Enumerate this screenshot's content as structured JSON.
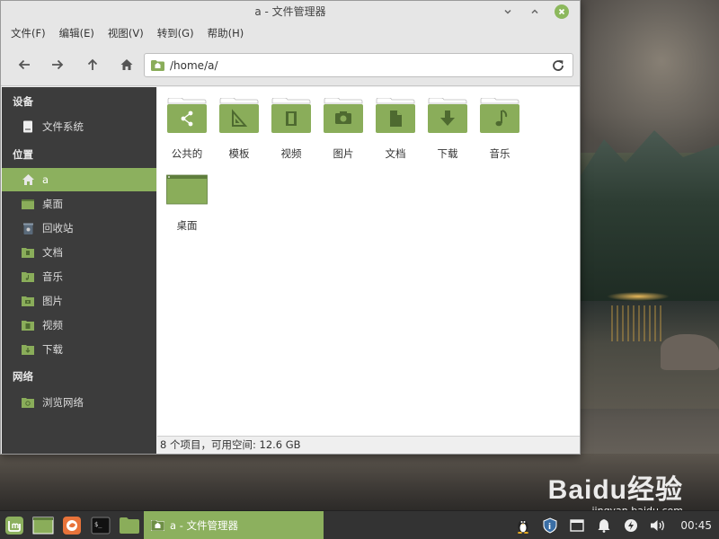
{
  "window": {
    "title": "a - 文件管理器",
    "controls": {
      "minimize": "˅",
      "maximize": "˄",
      "close": "✕"
    }
  },
  "menubar": {
    "items": [
      {
        "label": "文件(F)"
      },
      {
        "label": "编辑(E)"
      },
      {
        "label": "视图(V)"
      },
      {
        "label": "转到(G)"
      },
      {
        "label": "帮助(H)"
      }
    ]
  },
  "toolbar": {
    "back_icon": "arrow-left-icon",
    "forward_icon": "arrow-right-icon",
    "up_icon": "arrow-up-icon",
    "home_icon": "home-icon",
    "location": "/home/a/",
    "reload_icon": "reload-icon"
  },
  "sidebar": {
    "sections": [
      {
        "header": "设备",
        "items": [
          {
            "label": "文件系统",
            "icon": "drive-icon"
          }
        ]
      },
      {
        "header": "位置",
        "items": [
          {
            "label": "a",
            "icon": "home-icon",
            "active": true
          },
          {
            "label": "桌面",
            "icon": "desktop-icon"
          },
          {
            "label": "回收站",
            "icon": "trash-icon"
          },
          {
            "label": "文档",
            "icon": "documents-folder-icon"
          },
          {
            "label": "音乐",
            "icon": "music-folder-icon"
          },
          {
            "label": "图片",
            "icon": "pictures-folder-icon"
          },
          {
            "label": "视频",
            "icon": "videos-folder-icon"
          },
          {
            "label": "下载",
            "icon": "downloads-folder-icon"
          }
        ]
      },
      {
        "header": "网络",
        "items": [
          {
            "label": "浏览网络",
            "icon": "network-folder-icon"
          }
        ]
      }
    ]
  },
  "content": {
    "folders": [
      {
        "label": "公共的",
        "icon": "share-icon"
      },
      {
        "label": "模板",
        "icon": "template-icon"
      },
      {
        "label": "视频",
        "icon": "film-icon"
      },
      {
        "label": "图片",
        "icon": "camera-icon"
      },
      {
        "label": "文档",
        "icon": "document-icon"
      },
      {
        "label": "下载",
        "icon": "download-arrow-icon"
      },
      {
        "label": "音乐",
        "icon": "music-note-icon"
      },
      {
        "label": "桌面",
        "icon": "desktop-icon"
      }
    ]
  },
  "statusbar": {
    "text": "8 个项目，可用空间: 12.6 GB"
  },
  "taskbar": {
    "task_label": "a - 文件管理器",
    "clock": "00:45"
  },
  "watermark": {
    "logo": "Baidu经验",
    "url": "jingyan.baidu.com"
  },
  "colors": {
    "accent": "#8cb05e",
    "folder": "#8aad5a",
    "sidebar_bg": "#3c3c3c",
    "taskbar_bg": "#333333"
  }
}
